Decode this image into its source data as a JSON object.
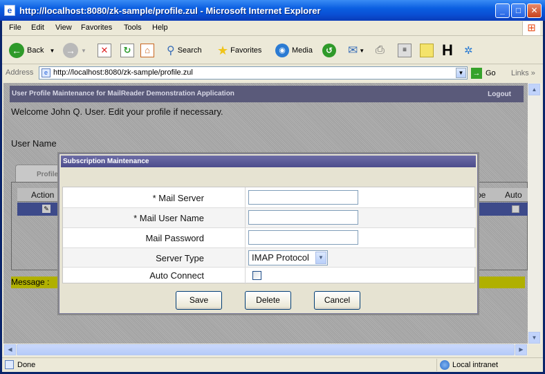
{
  "window": {
    "title": "http://localhost:8080/zk-sample/profile.zul - Microsoft Internet Explorer",
    "controls": [
      "minimize",
      "maximize",
      "close"
    ]
  },
  "menu": [
    "File",
    "Edit",
    "View",
    "Favorites",
    "Tools",
    "Help"
  ],
  "toolbar": {
    "back": "Back",
    "search": "Search",
    "favorites": "Favorites",
    "media": "Media"
  },
  "address": {
    "label": "Address",
    "url": "http://localhost:8080/zk-sample/profile.zul",
    "go": "Go",
    "links": "Links"
  },
  "page": {
    "header_title": "User Profile Maintenance for MailReader Demonstration Application",
    "logout": "Logout",
    "welcome": "Welcome John Q. User. Edit your profile if necessary.",
    "username_label": "User Name",
    "tab_label": "Profile",
    "grid_columns": {
      "action": "Action",
      "type": "pe",
      "auto": "Auto"
    },
    "message_label": "Message :"
  },
  "modal": {
    "title": "Subscription Maintenance",
    "fields": {
      "mail_server": {
        "label": "* Mail Server",
        "value": ""
      },
      "mail_user": {
        "label": "* Mail User Name",
        "value": ""
      },
      "mail_password": {
        "label": "Mail Password",
        "value": ""
      },
      "server_type": {
        "label": "Server Type",
        "value": "IMAP Protocol"
      },
      "auto_connect": {
        "label": "Auto Connect",
        "checked": false
      }
    },
    "buttons": {
      "save": "Save",
      "delete": "Delete",
      "cancel": "Cancel"
    }
  },
  "status": {
    "text": "Done",
    "zone": "Local intranet"
  }
}
